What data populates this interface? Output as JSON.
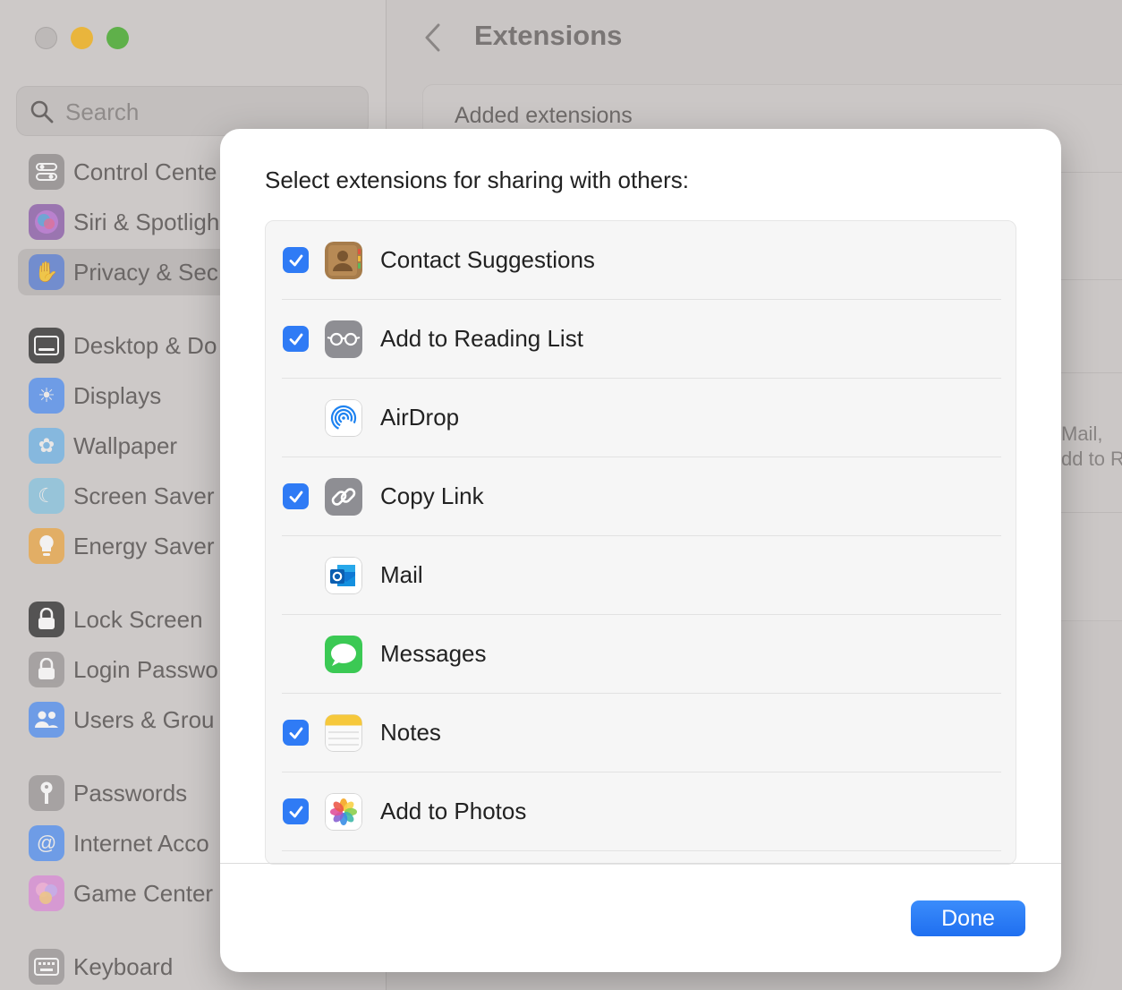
{
  "window": {
    "title": "Extensions"
  },
  "sidebar": {
    "search_placeholder": "Search",
    "items": [
      {
        "label": "Control Cente",
        "icon": "control-center-icon",
        "color": "#8d8a8a",
        "selected": false
      },
      {
        "label": "Siri & Spotligh",
        "icon": "siri-icon",
        "color": "#8a5aa8",
        "selected": false
      },
      {
        "label": "Privacy & Sec",
        "icon": "hand-icon",
        "color": "#5a7fd6",
        "selected": true
      },
      {
        "label": "Desktop & Do",
        "icon": "desktop-dock-icon",
        "color": "#2c2c2c",
        "selected": false
      },
      {
        "label": "Displays",
        "icon": "displays-icon",
        "color": "#4f8ef0",
        "selected": false
      },
      {
        "label": "Wallpaper",
        "icon": "wallpaper-icon",
        "color": "#6fb3e6",
        "selected": false
      },
      {
        "label": "Screen Saver",
        "icon": "screen-saver-icon",
        "color": "#86c3df",
        "selected": false
      },
      {
        "label": "Energy Saver",
        "icon": "energy-saver-icon",
        "color": "#e9a545",
        "selected": false
      },
      {
        "label": "Lock Screen",
        "icon": "lock-screen-icon",
        "color": "#2c2c2c",
        "selected": false
      },
      {
        "label": "Login Passwo",
        "icon": "login-password-icon",
        "color": "#9a9696",
        "selected": false
      },
      {
        "label": "Users & Grou",
        "icon": "users-groups-icon",
        "color": "#4f8ef0",
        "selected": false
      },
      {
        "label": "Passwords",
        "icon": "passwords-icon",
        "color": "#9a9696",
        "selected": false
      },
      {
        "label": "Internet Acco",
        "icon": "internet-accounts-icon",
        "color": "#4f8ef0",
        "selected": false
      },
      {
        "label": "Game Center",
        "icon": "game-center-icon",
        "color": "#d98ad6",
        "selected": false
      },
      {
        "label": "Keyboard",
        "icon": "keyboard-icon",
        "color": "#9a9696",
        "selected": false
      }
    ]
  },
  "main": {
    "card_heading": "Added extensions",
    "bg_text_1": "Mail,",
    "bg_text_2": "dd to R"
  },
  "dialog": {
    "prompt": "Select extensions for sharing with others:",
    "items": [
      {
        "label": "Contact Suggestions",
        "checked": true,
        "icon": "contacts-icon"
      },
      {
        "label": "Add to Reading List",
        "checked": true,
        "icon": "reading-list-icon"
      },
      {
        "label": "AirDrop",
        "checked": false,
        "icon": "airdrop-icon"
      },
      {
        "label": "Copy Link",
        "checked": true,
        "icon": "link-icon"
      },
      {
        "label": "Mail",
        "checked": false,
        "icon": "outlook-mail-icon"
      },
      {
        "label": "Messages",
        "checked": false,
        "icon": "messages-icon"
      },
      {
        "label": "Notes",
        "checked": true,
        "icon": "notes-icon"
      },
      {
        "label": "Add to Photos",
        "checked": true,
        "icon": "photos-icon"
      }
    ],
    "done_label": "Done",
    "accent_color": "#2f7bf5"
  }
}
